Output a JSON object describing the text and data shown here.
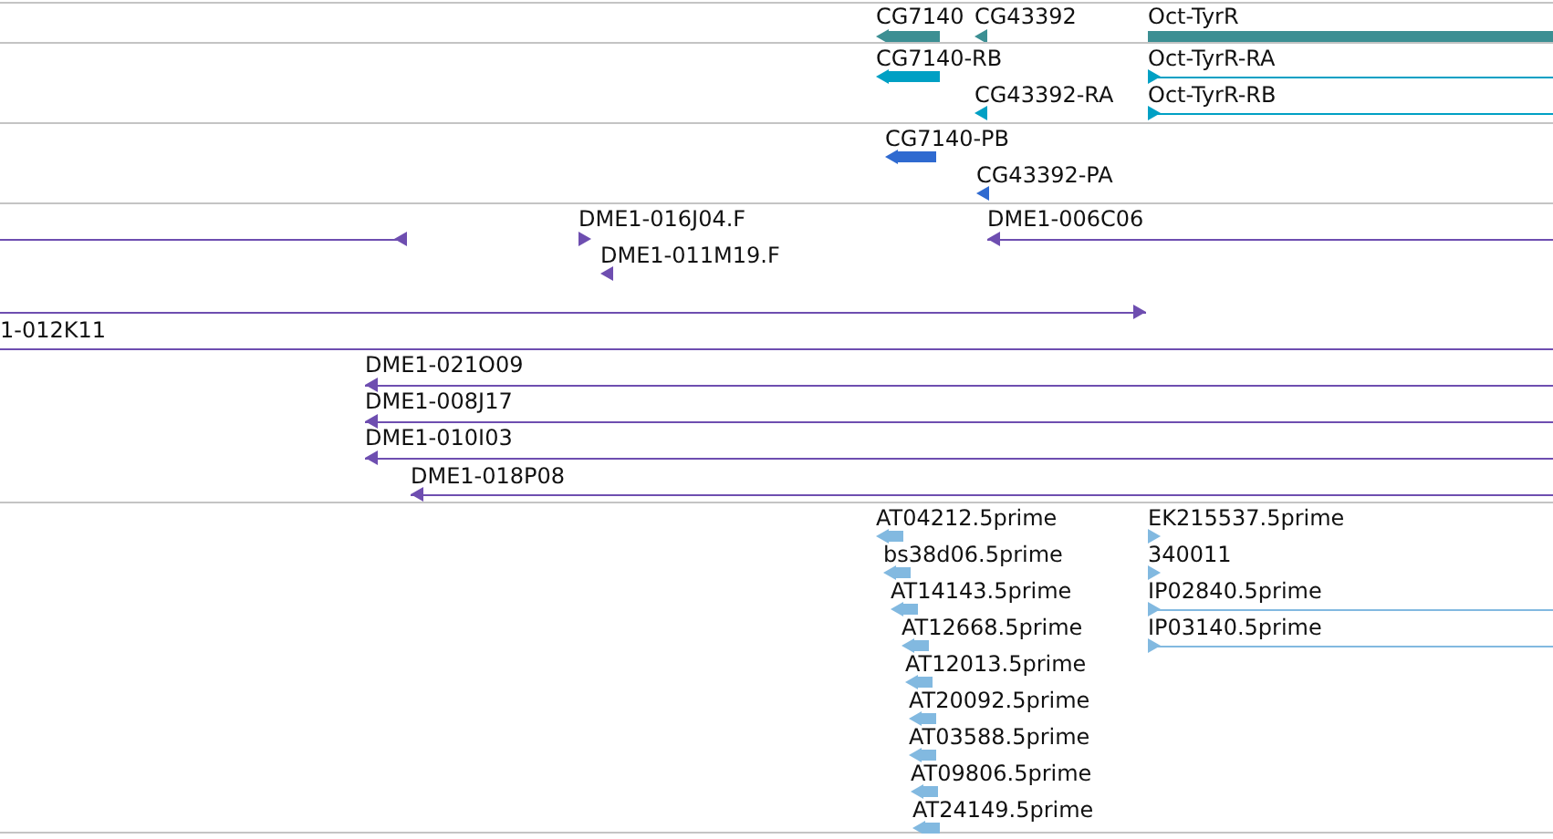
{
  "tracks": [
    {
      "color": "#3c8f93",
      "features": [
        {
          "label": "CG7140",
          "reverse": true
        },
        {
          "label": "CG43392",
          "reverse": true
        },
        {
          "label": "Oct-TyrR"
        }
      ]
    },
    {
      "color": "#00a0c4",
      "features": [
        {
          "label": "CG7140-RB",
          "reverse": true
        },
        {
          "label": "CG43392-RA",
          "reverse": true
        },
        {
          "label": "Oct-TyrR-RA",
          "reverse": false
        },
        {
          "label": "Oct-TyrR-RB",
          "reverse": false
        }
      ]
    },
    {
      "color": "#2f6ad0",
      "features": [
        {
          "label": "CG7140-PB",
          "reverse": true
        },
        {
          "label": "CG43392-PA",
          "reverse": true
        }
      ]
    },
    {
      "color": "#6e4eb0",
      "features": [
        {
          "reverse": true
        },
        {
          "label": "DME1-016J04.F",
          "reverse": false
        },
        {
          "label": "DME1-006C06",
          "reverse": true
        },
        {
          "label": "DME1-011M19.F",
          "reverse": true
        },
        {
          "reverse": false
        },
        {
          "label": "1-012K11"
        },
        {
          "label": "DME1-021O09",
          "reverse": true
        },
        {
          "label": "DME1-008J17",
          "reverse": true
        },
        {
          "label": "DME1-010I03",
          "reverse": true
        },
        {
          "label": "DME1-018P08",
          "reverse": true
        }
      ]
    },
    {
      "color": "#82b9e0",
      "features": [
        {
          "label": "AT04212.5prime",
          "reverse": true
        },
        {
          "label": "bs38d06.5prime",
          "reverse": true
        },
        {
          "label": "AT14143.5prime",
          "reverse": true
        },
        {
          "label": "AT12668.5prime",
          "reverse": true
        },
        {
          "label": "AT12013.5prime",
          "reverse": true
        },
        {
          "label": "AT20092.5prime",
          "reverse": true
        },
        {
          "label": "AT03588.5prime",
          "reverse": true
        },
        {
          "label": "AT09806.5prime",
          "reverse": true
        },
        {
          "label": "AT24149.5prime",
          "reverse": true
        },
        {
          "label": "EK215537.5prime",
          "reverse": false
        },
        {
          "label": "340011",
          "reverse": false
        },
        {
          "label": "IP02840.5prime",
          "reverse": false
        },
        {
          "label": "IP03140.5prime",
          "reverse": false
        }
      ]
    }
  ]
}
